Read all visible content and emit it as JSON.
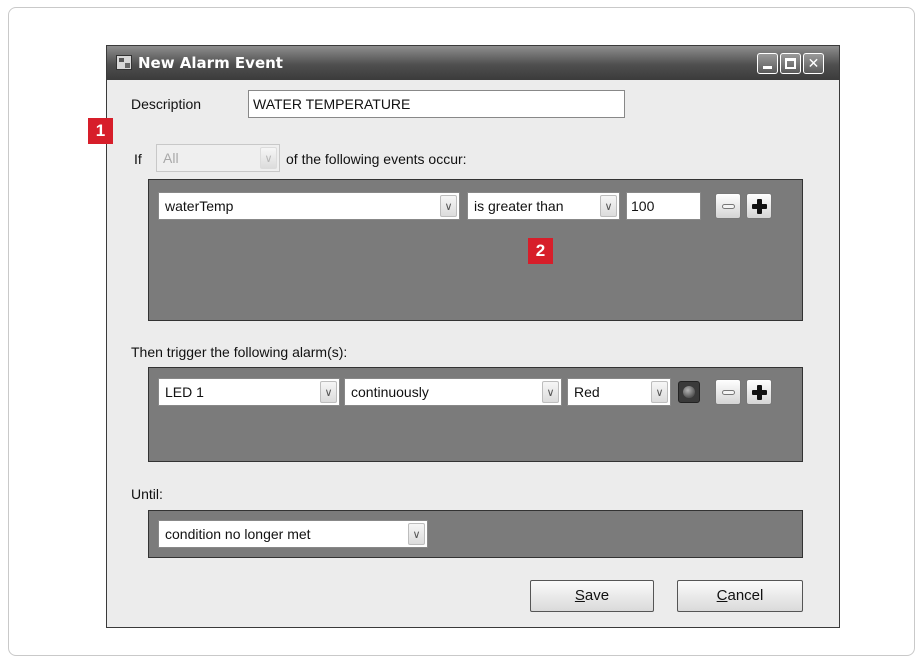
{
  "window": {
    "title": "New Alarm Event",
    "buttons": {
      "minimize": "minimize-icon",
      "maximize": "maximize-icon",
      "close": "✕"
    }
  },
  "description": {
    "label": "Description",
    "value": "WATER TEMPERATURE"
  },
  "if_row": {
    "label": "If",
    "quantifier": "All",
    "suffix": "of the following events occur:"
  },
  "condition": {
    "variable": "waterTemp",
    "operator": "is greater than",
    "value": "100"
  },
  "then_label": "Then trigger the following alarm(s):",
  "alarm": {
    "device": "LED 1",
    "mode": "continuously",
    "color": "Red"
  },
  "until": {
    "label": "Until:",
    "value": "condition no longer met"
  },
  "actions": {
    "save": {
      "mnemonic": "S",
      "rest": "ave"
    },
    "cancel": {
      "mnemonic": "C",
      "rest": "ancel"
    }
  },
  "callouts": [
    "1",
    "2"
  ],
  "colors": {
    "callout": "#d71e2a",
    "panel": "#7b7b7b",
    "titlebar": "#4f4f4f"
  }
}
